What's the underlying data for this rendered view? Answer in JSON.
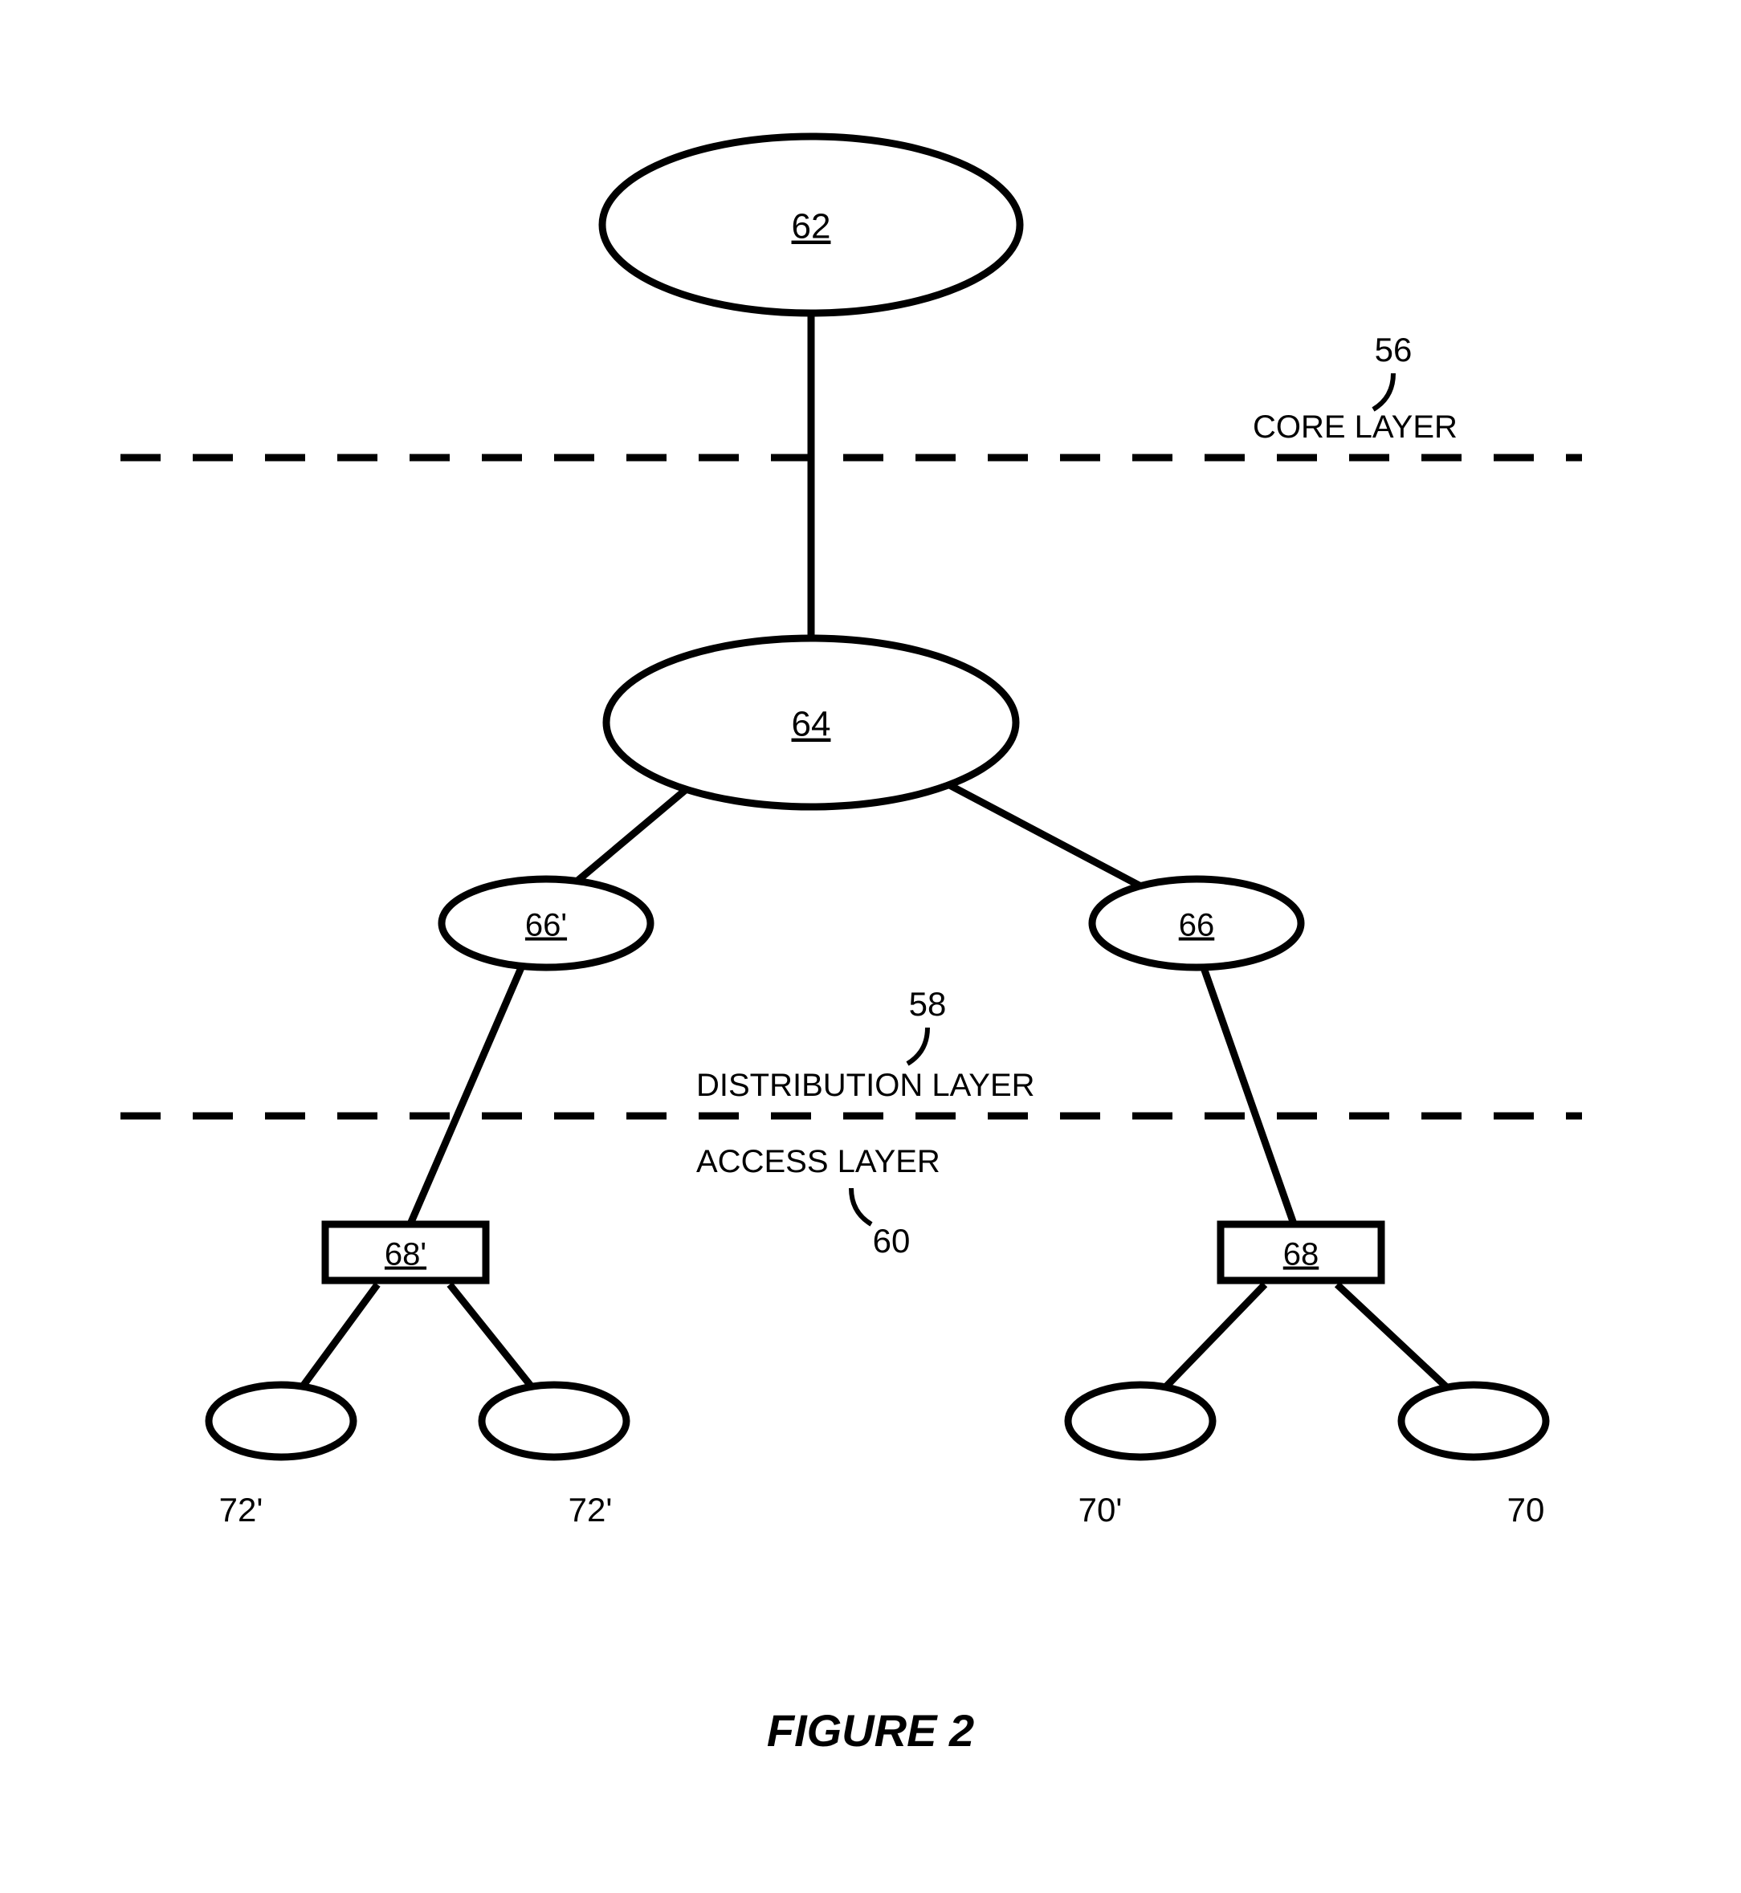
{
  "figure_caption": "FIGURE 2",
  "layers": {
    "core": {
      "ref": "56",
      "label": "CORE LAYER"
    },
    "distribution": {
      "ref": "58",
      "label": "DISTRIBUTION LAYER"
    },
    "access": {
      "ref": "60",
      "label": "ACCESS LAYER"
    }
  },
  "nodes": {
    "n62": "62",
    "n64": "64",
    "n66prime": "66'",
    "n66": "66",
    "n68prime": "68'",
    "n68": "68"
  },
  "leaves": {
    "l72a": "72'",
    "l72b": "72'",
    "l70a": "70'",
    "l70b": "70"
  }
}
